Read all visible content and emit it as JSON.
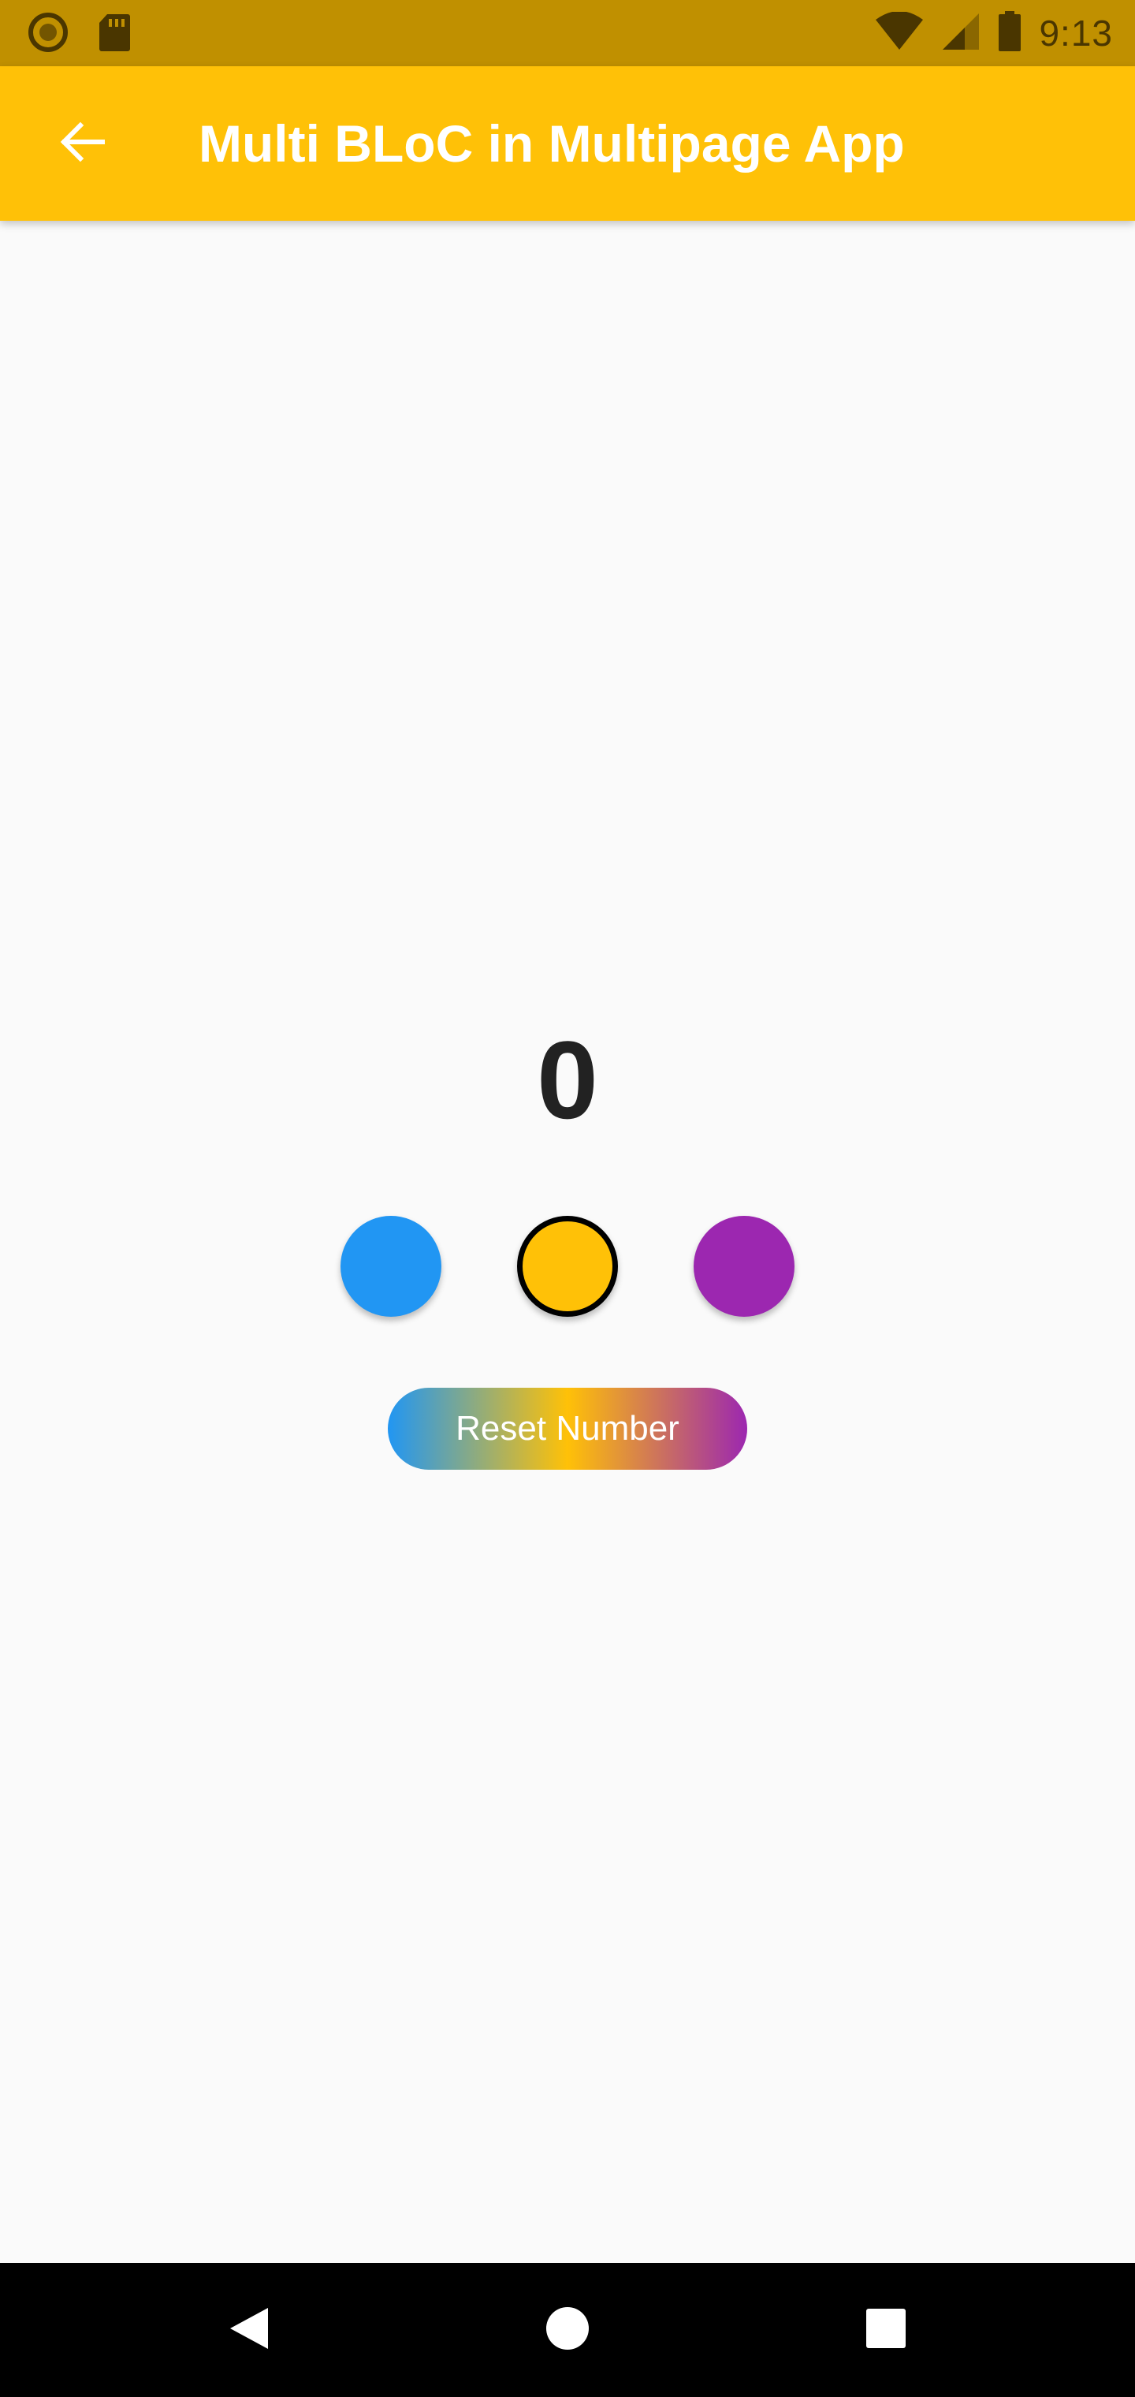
{
  "status_bar": {
    "time": "9:13",
    "icons": [
      "record-icon",
      "sd-card-icon",
      "wifi-icon",
      "cell-signal-icon",
      "battery-icon"
    ]
  },
  "app_bar": {
    "title": "Multi BLoC in Multipage App",
    "back_icon": "arrow-back-icon"
  },
  "counter": {
    "value": "0"
  },
  "color_options": [
    {
      "name": "blue",
      "color": "#2196f3",
      "selected": false
    },
    {
      "name": "amber",
      "color": "#ffc107",
      "selected": true
    },
    {
      "name": "purple",
      "color": "#9c27b0",
      "selected": false
    }
  ],
  "reset_button": {
    "label": "Reset Number",
    "gradient": [
      "#2196f3",
      "#ffc107",
      "#9c27b0"
    ]
  },
  "nav_bar": {
    "icons": [
      "nav-back-icon",
      "nav-home-icon",
      "nav-recents-icon"
    ]
  },
  "colors": {
    "status_bar": "#c09000",
    "app_bar": "#ffc107",
    "background": "#fafafa",
    "counter_text": "#222222"
  }
}
